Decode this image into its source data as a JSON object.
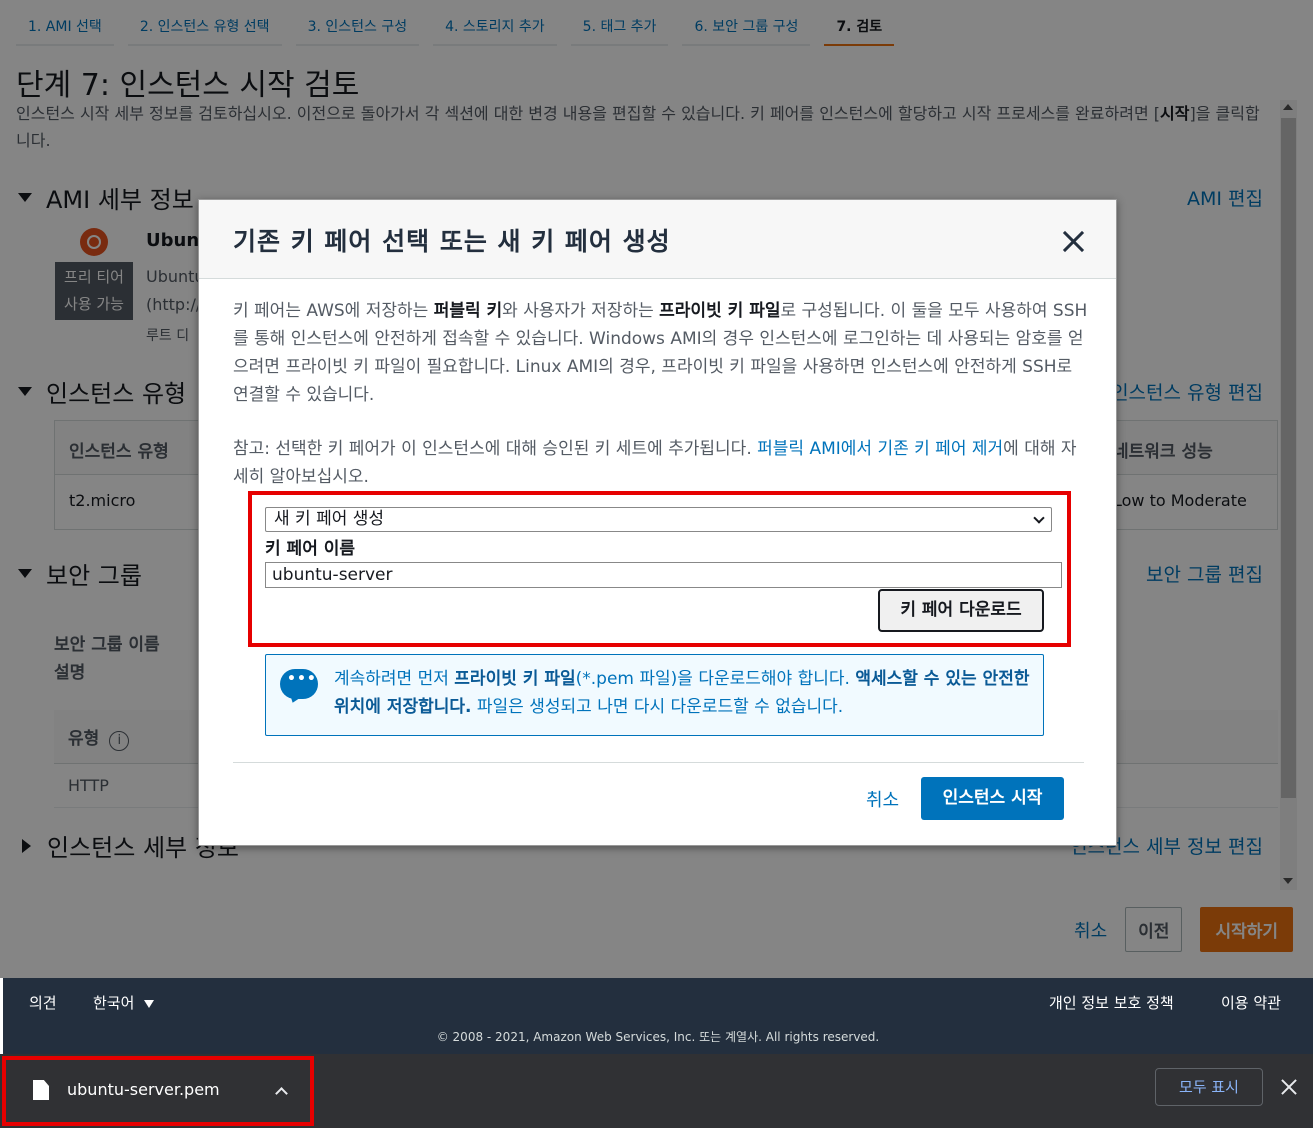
{
  "wizard": {
    "steps": [
      "1. AMI 선택",
      "2. 인스턴스 유형 선택",
      "3. 인스턴스 구성",
      "4. 스토리지 추가",
      "5. 태그 추가",
      "6. 보안 그룹 구성",
      "7. 검토"
    ],
    "title": "단계 7: 인스턴스 시작 검토",
    "desc_part1": "인스턴스 시작 세부 정보를 검토하십시오. 이전으로 돌아가서 각 섹션에 대한 변경 내용을 편집할 수 있습니다. 키 페어를 인스턴스에 할당하고 시작 프로세스를 완료하려면 [",
    "desc_bold": "시작",
    "desc_part2": "]을 클릭합니다."
  },
  "sections": {
    "ami": {
      "title": "AMI 세부 정보",
      "edit": "AMI 편집",
      "name": "Ubun",
      "desc_line1": "Ubuntu",
      "desc_line2": "(http://",
      "root": "루트 디",
      "free_tier": "프리 티어 사용 가능"
    },
    "instance_type": {
      "title": "인스턴스 유형",
      "edit": "인스턴스 유형 편집",
      "col1": "인스턴스 유형",
      "col_net": "네트워크 성능",
      "val1": "t2.micro",
      "val_net": "Low to Moderate"
    },
    "security": {
      "title": "보안 그룹",
      "edit": "보안 그룹 편집",
      "name_label": "보안 그룹 이름",
      "desc_label": "설명",
      "type_header": "유형",
      "row_type": "HTTP"
    },
    "instance_details": {
      "title": "인스턴스 세부 정보",
      "edit": "인스턴스 세부 정보 편집"
    }
  },
  "page_actions": {
    "cancel": "취소",
    "previous": "이전",
    "launch": "시작하기"
  },
  "modal": {
    "title": "기존 키 페어 선택 또는 새 키 페어 생성",
    "body_p1_a": "키 페어는 AWS에 저장하는 ",
    "body_p1_b": "퍼블릭 키",
    "body_p1_c": "와 사용자가 저장하는 ",
    "body_p1_d": "프라이빗 키 파일",
    "body_p1_e": "로 구성됩니다. 이 둘을 모두 사용하여 SSH를 통해 인스턴스에 안전하게 접속할 수 있습니다. Windows AMI의 경우 인스턴스에 로그인하는 데 사용되는 암호를 얻으려면 프라이빗 키 파일이 필요합니다. Linux AMI의 경우, 프라이빗 키 파일을 사용하면 인스턴스에 안전하게 SSH로 연결할 수 있습니다.",
    "note_a": "참고: 선택한 키 페어가 이 인스턴스에 대해 승인된 키 세트에 추가됩니다. ",
    "note_link": "퍼블릭 AMI에서 기존 키 페어 제거",
    "note_b": "에 대해 자세히 알아보십시오.",
    "select_value": "새 키 페어 생성",
    "keypair_label": "키 페어 이름",
    "keypair_value": "ubuntu-server",
    "download_button": "키 페어 다운로드",
    "alert_a": "계속하려면 먼저 ",
    "alert_b": "프라이빗 키 파일",
    "alert_c": "(*.pem 파일)을 다운로드해야 합니다. ",
    "alert_d": "액세스할 수 있는 안전한 위치에 저장합니다.",
    "alert_e": " 파일은 생성되고 나면 다시 다운로드할 수 없습니다.",
    "cancel": "취소",
    "launch": "인스턴스 시작"
  },
  "footer": {
    "feedback": "의견",
    "language": "한국어",
    "privacy": "개인 정보 보호 정책",
    "terms": "이용 약관",
    "copyright": "© 2008 - 2021, Amazon Web Services, Inc. 또는 계열사. All rights reserved."
  },
  "download_bar": {
    "file_name": "ubuntu-server.pem",
    "show_all": "모두 표시"
  },
  "colors": {
    "accent_orange": "#ec7211",
    "link_blue": "#0073bb",
    "highlight_red": "#e60000",
    "footer_bg": "#232f3e"
  }
}
